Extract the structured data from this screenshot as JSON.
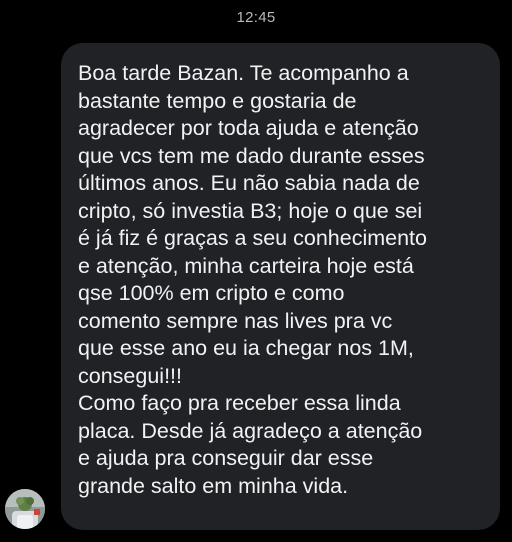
{
  "status": {
    "time": "12:45"
  },
  "conversation": {
    "message": {
      "lines": [
        "Boa tarde Bazan. Te acompanho a",
        "bastante tempo e gostaria de",
        "agradecer por toda ajuda e atenção",
        "que vcs tem me dado durante esses",
        "últimos anos. Eu não sabia nada de",
        "cripto, só investia B3; hoje o que sei",
        "é já fiz é graças a seu conhecimento",
        "e atenção, minha carteira hoje está",
        "qse 100% em cripto e como",
        "comento sempre nas lives pra vc",
        "que esse ano eu ia chegar nos 1M,",
        "consegui!!!",
        "Como faço pra receber essa linda",
        "placa. Desde já agradeço a atenção",
        "e ajuda pra conseguir dar esse",
        "grande salto em minha vida."
      ]
    },
    "sender_avatar": {
      "icon": "contact-avatar-icon"
    }
  },
  "colors": {
    "background": "#000000",
    "bubble": "#212226",
    "text": "#f2f2f4",
    "timestamp": "#b9b9bf"
  }
}
